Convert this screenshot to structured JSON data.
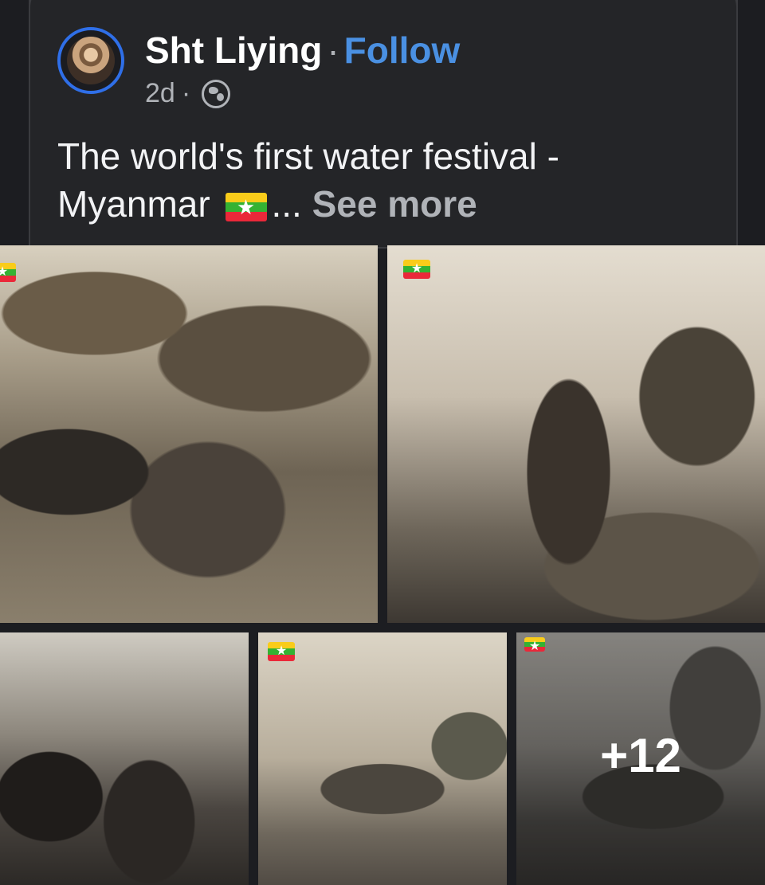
{
  "post": {
    "author": "Sht Liying",
    "separator": "·",
    "follow_label": "Follow",
    "time": "2d",
    "time_separator": "·",
    "text_line1": "The world's first water festival -",
    "text_line2": "Myanmar",
    "ellipsis": "...",
    "see_more": "See more"
  },
  "photos": {
    "more_count": "+12"
  },
  "icons": {
    "audience": "globe-icon",
    "flag": "myanmar-flag-icon"
  },
  "colors": {
    "background": "#1c1d21",
    "follow": "#4a90e2",
    "avatar_ring": "#2f6fe8",
    "muted": "#b0b3b8"
  }
}
